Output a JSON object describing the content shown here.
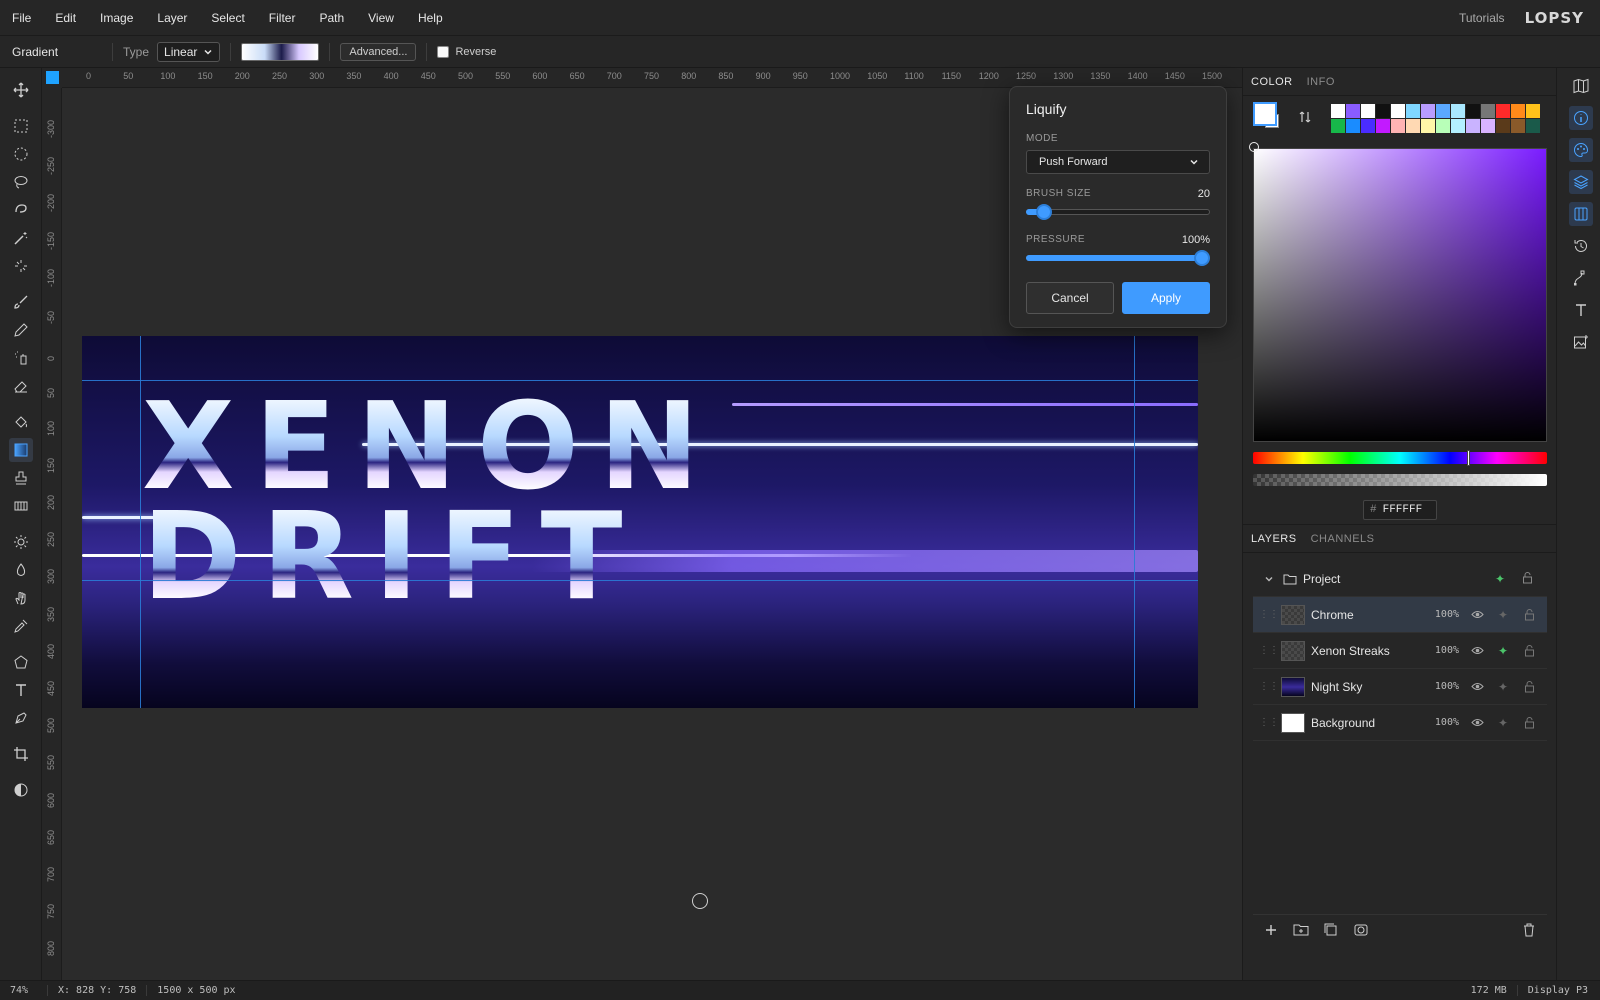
{
  "menu": {
    "items": [
      "File",
      "Edit",
      "Image",
      "Layer",
      "Select",
      "Filter",
      "Path",
      "View",
      "Help"
    ],
    "tutorials": "Tutorials",
    "logo": "LOPSY"
  },
  "options": {
    "tool_name": "Gradient",
    "type_label": "Type",
    "type_value": "Linear",
    "advanced_label": "Advanced...",
    "reverse_label": "Reverse"
  },
  "ruler": {
    "top": [
      "0",
      "50",
      "100",
      "150",
      "200",
      "250",
      "300",
      "350",
      "400",
      "450",
      "500",
      "550",
      "600",
      "650",
      "700",
      "750",
      "800",
      "850",
      "900",
      "950",
      "1000",
      "1050",
      "1100",
      "1150",
      "1200",
      "1250",
      "1300",
      "1350",
      "1400",
      "1450",
      "1500"
    ],
    "left": [
      "-300",
      "-250",
      "-200",
      "-150",
      "-100",
      "-50",
      "0",
      "50",
      "100",
      "150",
      "200",
      "250",
      "300",
      "350",
      "400",
      "450",
      "500",
      "550",
      "600",
      "650",
      "700",
      "750",
      "800"
    ]
  },
  "artwork": {
    "line1": "XENON",
    "line2": "DRIFT"
  },
  "liquify": {
    "title": "Liquify",
    "mode_label": "MODE",
    "mode_value": "Push Forward",
    "brush_size_label": "BRUSH SIZE",
    "brush_size_value": "20",
    "brush_size_fraction": 0.06,
    "pressure_label": "PRESSURE",
    "pressure_value": "100%",
    "pressure_fraction": 1.0,
    "cancel_label": "Cancel",
    "apply_label": "Apply"
  },
  "color_panel": {
    "tabs": [
      "COLOR",
      "INFO"
    ],
    "hex_value": "FFFFFF",
    "hash": "#",
    "swatches": [
      "#ffffff",
      "#8a5cff",
      "#ffffff",
      "#111111",
      "#ffffff",
      "#7fd6ff",
      "#b99cff",
      "#5aa8ff",
      "#a9e8ff",
      "#111111",
      "#777777",
      "#ff2a2a",
      "#ff8a1a",
      "#ffc21a",
      "#17b84a",
      "#1a8cff",
      "#4a2cff",
      "#c21aff",
      "#ffb3b3",
      "#ffd9b3",
      "#fff7a8",
      "#b8ffb8",
      "#b3f0ff",
      "#c9b3ff",
      "#d9b3ff",
      "#5a3a1a",
      "#8a5a2a",
      "#1a5a4a"
    ]
  },
  "layers_panel": {
    "tabs": [
      "LAYERS",
      "CHANNELS"
    ],
    "group_name": "Project",
    "layers": [
      {
        "name": "Chrome",
        "opacity": "100%"
      },
      {
        "name": "Xenon Streaks",
        "opacity": "100%"
      },
      {
        "name": "Night Sky",
        "opacity": "100%"
      },
      {
        "name": "Background",
        "opacity": "100%"
      }
    ]
  },
  "status": {
    "zoom": "74%",
    "coords": "X: 828  Y: 758",
    "dims": "1500 x 500 px",
    "memory": "172 MB",
    "profile": "Display P3"
  }
}
